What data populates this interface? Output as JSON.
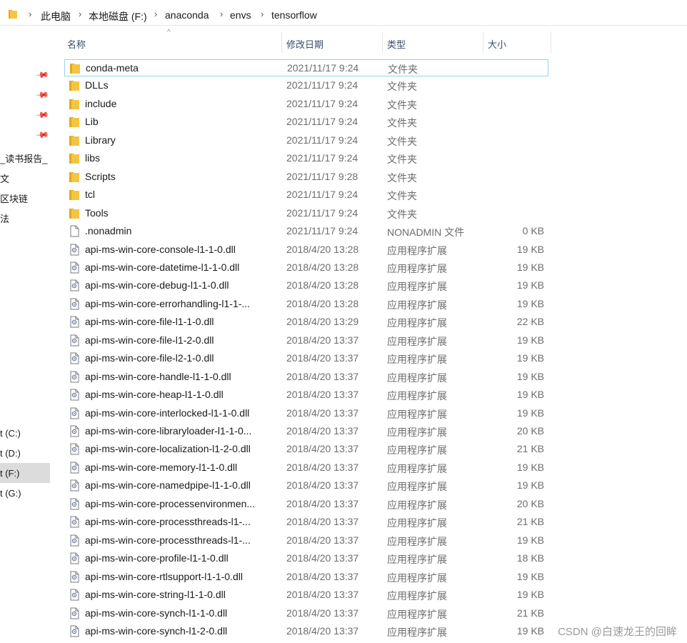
{
  "address": {
    "crumbs": [
      "此电脑",
      "本地磁盘 (F:)",
      "anaconda",
      "envs",
      "tensorflow"
    ]
  },
  "nav": {
    "items": [
      "_读书报告_",
      "文",
      "区块链",
      "法",
      "t (C:)",
      "t (D:)",
      "t (F:)",
      "t (G:)"
    ],
    "selected_index": 6
  },
  "columns": {
    "name": "名称",
    "date": "修改日期",
    "type": "类型",
    "size": "大小"
  },
  "files": [
    {
      "name": "conda-meta",
      "date": "2021/11/17 9:24",
      "type": "文件夹",
      "size": "",
      "icon": "folder"
    },
    {
      "name": "DLLs",
      "date": "2021/11/17 9:24",
      "type": "文件夹",
      "size": "",
      "icon": "folder"
    },
    {
      "name": "include",
      "date": "2021/11/17 9:24",
      "type": "文件夹",
      "size": "",
      "icon": "folder"
    },
    {
      "name": "Lib",
      "date": "2021/11/17 9:24",
      "type": "文件夹",
      "size": "",
      "icon": "folder"
    },
    {
      "name": "Library",
      "date": "2021/11/17 9:24",
      "type": "文件夹",
      "size": "",
      "icon": "folder"
    },
    {
      "name": "libs",
      "date": "2021/11/17 9:24",
      "type": "文件夹",
      "size": "",
      "icon": "folder"
    },
    {
      "name": "Scripts",
      "date": "2021/11/17 9:28",
      "type": "文件夹",
      "size": "",
      "icon": "folder"
    },
    {
      "name": "tcl",
      "date": "2021/11/17 9:24",
      "type": "文件夹",
      "size": "",
      "icon": "folder"
    },
    {
      "name": "Tools",
      "date": "2021/11/17 9:24",
      "type": "文件夹",
      "size": "",
      "icon": "folder"
    },
    {
      "name": ".nonadmin",
      "date": "2021/11/17 9:24",
      "type": "NONADMIN 文件",
      "size": "0 KB",
      "icon": "file"
    },
    {
      "name": "api-ms-win-core-console-l1-1-0.dll",
      "date": "2018/4/20 13:28",
      "type": "应用程序扩展",
      "size": "19 KB",
      "icon": "dll"
    },
    {
      "name": "api-ms-win-core-datetime-l1-1-0.dll",
      "date": "2018/4/20 13:28",
      "type": "应用程序扩展",
      "size": "19 KB",
      "icon": "dll"
    },
    {
      "name": "api-ms-win-core-debug-l1-1-0.dll",
      "date": "2018/4/20 13:28",
      "type": "应用程序扩展",
      "size": "19 KB",
      "icon": "dll"
    },
    {
      "name": "api-ms-win-core-errorhandling-l1-1-...",
      "date": "2018/4/20 13:28",
      "type": "应用程序扩展",
      "size": "19 KB",
      "icon": "dll"
    },
    {
      "name": "api-ms-win-core-file-l1-1-0.dll",
      "date": "2018/4/20 13:29",
      "type": "应用程序扩展",
      "size": "22 KB",
      "icon": "dll"
    },
    {
      "name": "api-ms-win-core-file-l1-2-0.dll",
      "date": "2018/4/20 13:37",
      "type": "应用程序扩展",
      "size": "19 KB",
      "icon": "dll"
    },
    {
      "name": "api-ms-win-core-file-l2-1-0.dll",
      "date": "2018/4/20 13:37",
      "type": "应用程序扩展",
      "size": "19 KB",
      "icon": "dll"
    },
    {
      "name": "api-ms-win-core-handle-l1-1-0.dll",
      "date": "2018/4/20 13:37",
      "type": "应用程序扩展",
      "size": "19 KB",
      "icon": "dll"
    },
    {
      "name": "api-ms-win-core-heap-l1-1-0.dll",
      "date": "2018/4/20 13:37",
      "type": "应用程序扩展",
      "size": "19 KB",
      "icon": "dll"
    },
    {
      "name": "api-ms-win-core-interlocked-l1-1-0.dll",
      "date": "2018/4/20 13:37",
      "type": "应用程序扩展",
      "size": "19 KB",
      "icon": "dll"
    },
    {
      "name": "api-ms-win-core-libraryloader-l1-1-0...",
      "date": "2018/4/20 13:37",
      "type": "应用程序扩展",
      "size": "20 KB",
      "icon": "dll"
    },
    {
      "name": "api-ms-win-core-localization-l1-2-0.dll",
      "date": "2018/4/20 13:37",
      "type": "应用程序扩展",
      "size": "21 KB",
      "icon": "dll"
    },
    {
      "name": "api-ms-win-core-memory-l1-1-0.dll",
      "date": "2018/4/20 13:37",
      "type": "应用程序扩展",
      "size": "19 KB",
      "icon": "dll"
    },
    {
      "name": "api-ms-win-core-namedpipe-l1-1-0.dll",
      "date": "2018/4/20 13:37",
      "type": "应用程序扩展",
      "size": "19 KB",
      "icon": "dll"
    },
    {
      "name": "api-ms-win-core-processenvironmen...",
      "date": "2018/4/20 13:37",
      "type": "应用程序扩展",
      "size": "20 KB",
      "icon": "dll"
    },
    {
      "name": "api-ms-win-core-processthreads-l1-...",
      "date": "2018/4/20 13:37",
      "type": "应用程序扩展",
      "size": "21 KB",
      "icon": "dll"
    },
    {
      "name": "api-ms-win-core-processthreads-l1-...",
      "date": "2018/4/20 13:37",
      "type": "应用程序扩展",
      "size": "19 KB",
      "icon": "dll"
    },
    {
      "name": "api-ms-win-core-profile-l1-1-0.dll",
      "date": "2018/4/20 13:37",
      "type": "应用程序扩展",
      "size": "18 KB",
      "icon": "dll"
    },
    {
      "name": "api-ms-win-core-rtlsupport-l1-1-0.dll",
      "date": "2018/4/20 13:37",
      "type": "应用程序扩展",
      "size": "19 KB",
      "icon": "dll"
    },
    {
      "name": "api-ms-win-core-string-l1-1-0.dll",
      "date": "2018/4/20 13:37",
      "type": "应用程序扩展",
      "size": "19 KB",
      "icon": "dll"
    },
    {
      "name": "api-ms-win-core-synch-l1-1-0.dll",
      "date": "2018/4/20 13:37",
      "type": "应用程序扩展",
      "size": "21 KB",
      "icon": "dll"
    },
    {
      "name": "api-ms-win-core-synch-l1-2-0.dll",
      "date": "2018/4/20 13:37",
      "type": "应用程序扩展",
      "size": "19 KB",
      "icon": "dll"
    }
  ],
  "selected_row": 0,
  "watermark": "CSDN @白速龙王的回眸",
  "colors": {
    "folder": "#f5c542",
    "folder_dark": "#e0a91f",
    "selection_border": "#99d1f8",
    "nav_selected": "#dcdcdc"
  }
}
